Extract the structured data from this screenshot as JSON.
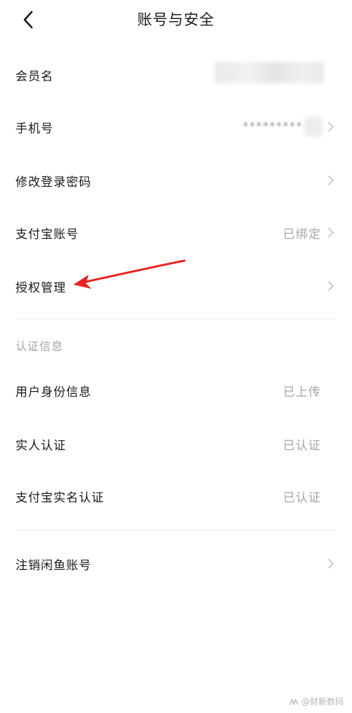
{
  "header": {
    "title": "账号与安全",
    "back_icon": "chevron-left-icon"
  },
  "account_rows": [
    {
      "label": "会员名",
      "value": ""
    },
    {
      "label": "手机号",
      "value": "*********"
    },
    {
      "label": "修改登录密码",
      "value": ""
    },
    {
      "label": "支付宝账号",
      "value": "已绑定"
    },
    {
      "label": "授权管理",
      "value": ""
    }
  ],
  "verification": {
    "section_title": "认证信息",
    "rows": [
      {
        "label": "用户身份信息",
        "value": "已上传"
      },
      {
        "label": "实人认证",
        "value": "已认证"
      },
      {
        "label": "支付宝实名认证",
        "value": "已认证"
      }
    ]
  },
  "danger_rows": [
    {
      "label": "注销闲鱼账号",
      "value": ""
    }
  ],
  "watermark": {
    "text": "@财新数码"
  },
  "colors": {
    "text_primary": "#1a1a1a",
    "text_secondary": "#a6a6a6",
    "chevron": "#c8c8c8",
    "annotation_arrow": "#e8231f",
    "divider": "#ececec"
  }
}
